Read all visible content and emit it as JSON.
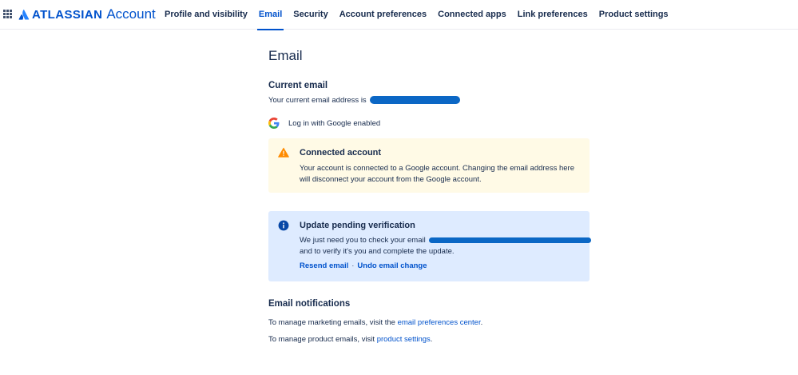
{
  "header": {
    "brand": "ATLASSIAN",
    "product": "Account",
    "tabs": [
      {
        "label": "Profile and visibility",
        "active": false
      },
      {
        "label": "Email",
        "active": true
      },
      {
        "label": "Security",
        "active": false
      },
      {
        "label": "Account preferences",
        "active": false
      },
      {
        "label": "Connected apps",
        "active": false
      },
      {
        "label": "Link preferences",
        "active": false
      },
      {
        "label": "Product settings",
        "active": false
      }
    ]
  },
  "main": {
    "title": "Email",
    "current_email": {
      "heading": "Current email",
      "text": "Your current email address is"
    },
    "google": {
      "label": "Log in with Google enabled"
    },
    "warning": {
      "title": "Connected account",
      "line1": "Your account is connected to a Google account. Changing the email address here",
      "line2": "will disconnect your account from the Google account."
    },
    "pending": {
      "title": "Update pending verification",
      "line1": "We just need you to check your email",
      "line2": "and to verify it's you and complete the update.",
      "resend": "Resend email",
      "separator": "·",
      "undo": "Undo email change"
    },
    "notifications": {
      "heading": "Email notifications",
      "marketing_prefix": "To manage marketing emails, visit the",
      "marketing_link": "email preferences center",
      "marketing_suffix": ".",
      "product_prefix": "To manage product emails, visit",
      "product_link": "product settings",
      "product_suffix": "."
    }
  },
  "colors": {
    "primary": "#0052cc",
    "text": "#172b4d",
    "warning_bg": "#fffae6",
    "warning_icon": "#ff8b00",
    "info_bg": "#deebff",
    "info_icon": "#0747a6",
    "redaction": "#0b67c5"
  }
}
